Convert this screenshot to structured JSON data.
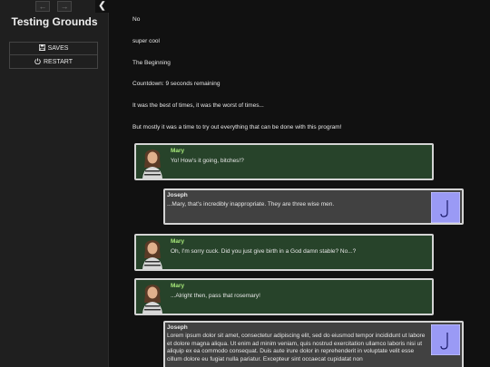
{
  "sidebar": {
    "history_back_icon": "arrow-left-icon",
    "history_forward_icon": "arrow-right-icon",
    "stow_icon": "chevron-left-icon",
    "story_title": "Testing Grounds",
    "menu": {
      "saves_label": "SAVES",
      "saves_icon": "save-icon",
      "restart_label": "RESTART",
      "restart_icon": "power-icon"
    }
  },
  "passage": {
    "lines": [
      "No",
      "super cool",
      "The Beginning",
      "Countdown: 9 seconds remaining",
      "It was the best of times, it was the worst of times...",
      "But mostly it was a time to try out everything that can be done with this program!"
    ],
    "chats": [
      {
        "speaker": "Mary",
        "text": "Yo! How's it going, bitches!?"
      },
      {
        "speaker": "Joseph",
        "text": "...Mary, that's incredibly inappropriate. They are three wise men."
      },
      {
        "speaker": "Mary",
        "text": "Oh, I'm sorry cuck. Did you just give birth in a God damn stable? No...?"
      },
      {
        "speaker": "Mary",
        "text": "...Alright then, pass that rosemary!"
      },
      {
        "speaker": "Joseph",
        "text": "Lorem ipsum dolor sit amet, consectetur adipiscing elit, sed do eiusmod tempor incididunt ut labore et dolore magna aliqua. Ut enim ad minim veniam, quis nostrud exercitation ullamco laboris nisi ut aliquip ex ea commodo consequat. Duis aute irure dolor in reprehenderit in voluptate velit esse cillum dolore eu fugiat nulla pariatur. Excepteur sint occaecat cupidatat non"
      }
    ],
    "colors": {
      "mary_bg": "#27432a",
      "mary_name": "#a6e879",
      "joseph_bg": "#414141",
      "joseph_avatar_bg": "#9a9af5"
    }
  }
}
